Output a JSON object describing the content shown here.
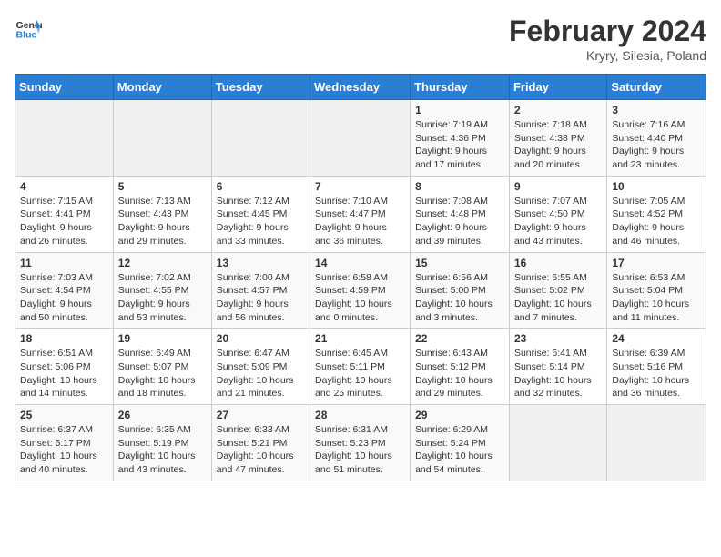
{
  "logo": {
    "text_general": "General",
    "text_blue": "Blue"
  },
  "header": {
    "title": "February 2024",
    "subtitle": "Kryry, Silesia, Poland"
  },
  "weekdays": [
    "Sunday",
    "Monday",
    "Tuesday",
    "Wednesday",
    "Thursday",
    "Friday",
    "Saturday"
  ],
  "weeks": [
    [
      {
        "day": "",
        "sunrise": "",
        "sunset": "",
        "daylight": ""
      },
      {
        "day": "",
        "sunrise": "",
        "sunset": "",
        "daylight": ""
      },
      {
        "day": "",
        "sunrise": "",
        "sunset": "",
        "daylight": ""
      },
      {
        "day": "",
        "sunrise": "",
        "sunset": "",
        "daylight": ""
      },
      {
        "day": "1",
        "sunrise": "Sunrise: 7:19 AM",
        "sunset": "Sunset: 4:36 PM",
        "daylight": "Daylight: 9 hours and 17 minutes."
      },
      {
        "day": "2",
        "sunrise": "Sunrise: 7:18 AM",
        "sunset": "Sunset: 4:38 PM",
        "daylight": "Daylight: 9 hours and 20 minutes."
      },
      {
        "day": "3",
        "sunrise": "Sunrise: 7:16 AM",
        "sunset": "Sunset: 4:40 PM",
        "daylight": "Daylight: 9 hours and 23 minutes."
      }
    ],
    [
      {
        "day": "4",
        "sunrise": "Sunrise: 7:15 AM",
        "sunset": "Sunset: 4:41 PM",
        "daylight": "Daylight: 9 hours and 26 minutes."
      },
      {
        "day": "5",
        "sunrise": "Sunrise: 7:13 AM",
        "sunset": "Sunset: 4:43 PM",
        "daylight": "Daylight: 9 hours and 29 minutes."
      },
      {
        "day": "6",
        "sunrise": "Sunrise: 7:12 AM",
        "sunset": "Sunset: 4:45 PM",
        "daylight": "Daylight: 9 hours and 33 minutes."
      },
      {
        "day": "7",
        "sunrise": "Sunrise: 7:10 AM",
        "sunset": "Sunset: 4:47 PM",
        "daylight": "Daylight: 9 hours and 36 minutes."
      },
      {
        "day": "8",
        "sunrise": "Sunrise: 7:08 AM",
        "sunset": "Sunset: 4:48 PM",
        "daylight": "Daylight: 9 hours and 39 minutes."
      },
      {
        "day": "9",
        "sunrise": "Sunrise: 7:07 AM",
        "sunset": "Sunset: 4:50 PM",
        "daylight": "Daylight: 9 hours and 43 minutes."
      },
      {
        "day": "10",
        "sunrise": "Sunrise: 7:05 AM",
        "sunset": "Sunset: 4:52 PM",
        "daylight": "Daylight: 9 hours and 46 minutes."
      }
    ],
    [
      {
        "day": "11",
        "sunrise": "Sunrise: 7:03 AM",
        "sunset": "Sunset: 4:54 PM",
        "daylight": "Daylight: 9 hours and 50 minutes."
      },
      {
        "day": "12",
        "sunrise": "Sunrise: 7:02 AM",
        "sunset": "Sunset: 4:55 PM",
        "daylight": "Daylight: 9 hours and 53 minutes."
      },
      {
        "day": "13",
        "sunrise": "Sunrise: 7:00 AM",
        "sunset": "Sunset: 4:57 PM",
        "daylight": "Daylight: 9 hours and 56 minutes."
      },
      {
        "day": "14",
        "sunrise": "Sunrise: 6:58 AM",
        "sunset": "Sunset: 4:59 PM",
        "daylight": "Daylight: 10 hours and 0 minutes."
      },
      {
        "day": "15",
        "sunrise": "Sunrise: 6:56 AM",
        "sunset": "Sunset: 5:00 PM",
        "daylight": "Daylight: 10 hours and 3 minutes."
      },
      {
        "day": "16",
        "sunrise": "Sunrise: 6:55 AM",
        "sunset": "Sunset: 5:02 PM",
        "daylight": "Daylight: 10 hours and 7 minutes."
      },
      {
        "day": "17",
        "sunrise": "Sunrise: 6:53 AM",
        "sunset": "Sunset: 5:04 PM",
        "daylight": "Daylight: 10 hours and 11 minutes."
      }
    ],
    [
      {
        "day": "18",
        "sunrise": "Sunrise: 6:51 AM",
        "sunset": "Sunset: 5:06 PM",
        "daylight": "Daylight: 10 hours and 14 minutes."
      },
      {
        "day": "19",
        "sunrise": "Sunrise: 6:49 AM",
        "sunset": "Sunset: 5:07 PM",
        "daylight": "Daylight: 10 hours and 18 minutes."
      },
      {
        "day": "20",
        "sunrise": "Sunrise: 6:47 AM",
        "sunset": "Sunset: 5:09 PM",
        "daylight": "Daylight: 10 hours and 21 minutes."
      },
      {
        "day": "21",
        "sunrise": "Sunrise: 6:45 AM",
        "sunset": "Sunset: 5:11 PM",
        "daylight": "Daylight: 10 hours and 25 minutes."
      },
      {
        "day": "22",
        "sunrise": "Sunrise: 6:43 AM",
        "sunset": "Sunset: 5:12 PM",
        "daylight": "Daylight: 10 hours and 29 minutes."
      },
      {
        "day": "23",
        "sunrise": "Sunrise: 6:41 AM",
        "sunset": "Sunset: 5:14 PM",
        "daylight": "Daylight: 10 hours and 32 minutes."
      },
      {
        "day": "24",
        "sunrise": "Sunrise: 6:39 AM",
        "sunset": "Sunset: 5:16 PM",
        "daylight": "Daylight: 10 hours and 36 minutes."
      }
    ],
    [
      {
        "day": "25",
        "sunrise": "Sunrise: 6:37 AM",
        "sunset": "Sunset: 5:17 PM",
        "daylight": "Daylight: 10 hours and 40 minutes."
      },
      {
        "day": "26",
        "sunrise": "Sunrise: 6:35 AM",
        "sunset": "Sunset: 5:19 PM",
        "daylight": "Daylight: 10 hours and 43 minutes."
      },
      {
        "day": "27",
        "sunrise": "Sunrise: 6:33 AM",
        "sunset": "Sunset: 5:21 PM",
        "daylight": "Daylight: 10 hours and 47 minutes."
      },
      {
        "day": "28",
        "sunrise": "Sunrise: 6:31 AM",
        "sunset": "Sunset: 5:23 PM",
        "daylight": "Daylight: 10 hours and 51 minutes."
      },
      {
        "day": "29",
        "sunrise": "Sunrise: 6:29 AM",
        "sunset": "Sunset: 5:24 PM",
        "daylight": "Daylight: 10 hours and 54 minutes."
      },
      {
        "day": "",
        "sunrise": "",
        "sunset": "",
        "daylight": ""
      },
      {
        "day": "",
        "sunrise": "",
        "sunset": "",
        "daylight": ""
      }
    ]
  ]
}
